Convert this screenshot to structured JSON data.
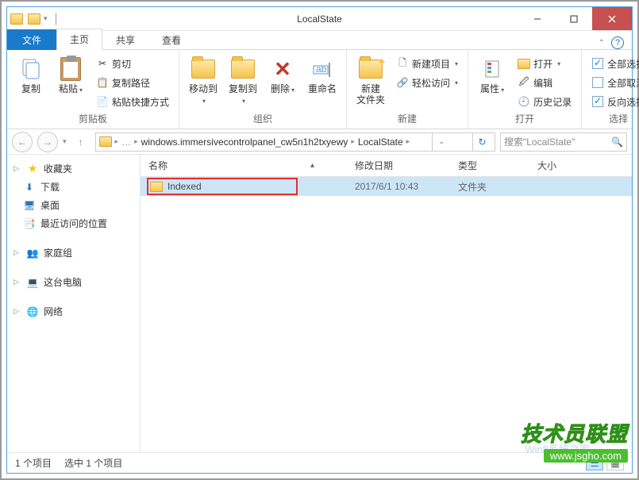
{
  "window": {
    "title": "LocalState"
  },
  "tabs": {
    "file": "文件",
    "home": "主页",
    "share": "共享",
    "view": "查看"
  },
  "ribbon": {
    "clipboard": {
      "label": "剪贴板",
      "copy": "复制",
      "paste": "粘贴",
      "cut": "剪切",
      "copypath": "复制路径",
      "paste_shortcut": "粘贴快捷方式"
    },
    "organize": {
      "label": "组织",
      "moveto": "移动到",
      "copyto": "复制到",
      "delete": "删除",
      "rename": "重命名"
    },
    "new": {
      "label": "新建",
      "newfolder": "新建\n文件夹",
      "newitem": "新建项目",
      "easyaccess": "轻松访问"
    },
    "open": {
      "label": "打开",
      "properties": "属性",
      "open": "打开",
      "edit": "编辑",
      "history": "历史记录"
    },
    "select": {
      "label": "选择",
      "all": "全部选择",
      "none": "全部取消",
      "invert": "反向选择"
    }
  },
  "breadcrumb": {
    "items": [
      "windows.immersivecontrolpanel_cw5n1h2txyewy",
      "LocalState"
    ]
  },
  "search": {
    "placeholder": "搜索\"LocalState\""
  },
  "nav": {
    "favorites": "收藏夹",
    "downloads": "下载",
    "desktop": "桌面",
    "recent": "最近访问的位置",
    "homegroup": "家庭组",
    "thispc": "这台电脑",
    "network": "网络"
  },
  "columns": {
    "name": "名称",
    "date": "修改日期",
    "type": "类型",
    "size": "大小"
  },
  "files": [
    {
      "name": "Indexed",
      "date": "2017/6/1 10:43",
      "type": "文件夹",
      "size": ""
    }
  ],
  "status": {
    "count": "1 个项目",
    "selected": "选中 1 个项目"
  },
  "watermark": {
    "brand": "技术员联盟",
    "url": "www.jsgho.com",
    "faint": "Win8系统之家"
  }
}
